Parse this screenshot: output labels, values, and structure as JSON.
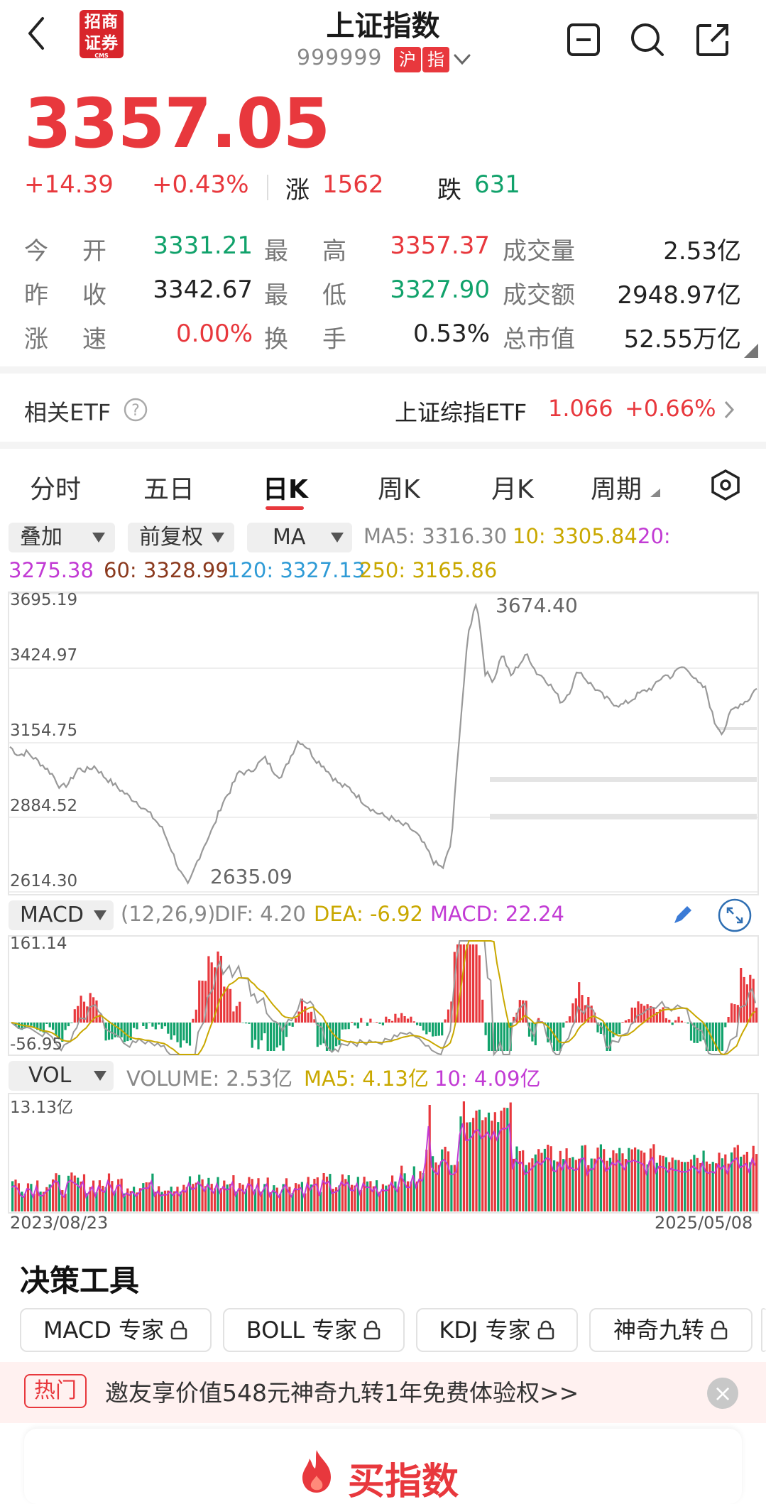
{
  "header": {
    "back_icon": "chevron-left-icon",
    "logo_text_top": "招商",
    "logo_text_bottom": "证券",
    "logo_small": "CMS",
    "title": "上证指数",
    "code": "999999",
    "tag1": "沪",
    "tag2": "指",
    "dropdown_icon": "chevron-down-icon",
    "icons": [
      "minus-square-icon",
      "search-icon",
      "share-icon"
    ]
  },
  "quote": {
    "price": "3357.05",
    "change": "+14.39",
    "change_pct": "+0.43%",
    "up_label": "涨",
    "up_count": "1562",
    "down_label": "跌",
    "down_count": "631",
    "rows": [
      {
        "l1": "今",
        "l2": "开",
        "v1": "3331.21",
        "c1": "green",
        "m1": "最",
        "m2": "高",
        "v2": "3357.37",
        "c2": "red",
        "n": "成交量",
        "v3": "2.53亿"
      },
      {
        "l1": "昨",
        "l2": "收",
        "v1": "3342.67",
        "c1": "dark",
        "m1": "最",
        "m2": "低",
        "v2": "3327.90",
        "c2": "green",
        "n": "成交额",
        "v3": "2948.97亿"
      },
      {
        "l1": "涨",
        "l2": "速",
        "v1": "0.00%",
        "c1": "red",
        "m1": "换",
        "m2": "手",
        "v2": "0.53%",
        "c2": "dark",
        "n": "总市值",
        "v3": "52.55万亿"
      }
    ]
  },
  "etf": {
    "label": "相关ETF",
    "name": "上证综指ETF",
    "price": "1.066",
    "pct": "+0.66%"
  },
  "tabs": [
    "分时",
    "五日",
    "日K",
    "周K",
    "月K",
    "周期"
  ],
  "active_tab": "日K",
  "controls": {
    "overlay": "叠加",
    "adjust": "前复权",
    "ma": "MA"
  },
  "ma_values": {
    "ma5": "MA5: 3316.30",
    "ma10": "10: 3305.84",
    "ma20_a": "20:",
    "ma20_b": "3275.38",
    "ma60": "60: 3328.99",
    "ma120": "120: 3327.13",
    "ma250": "250: 3165.86",
    "colors": {
      "ma5": "#888888",
      "ma10": "#c9a800",
      "ma20": "#c23bd4",
      "ma60": "#8b3a1e",
      "ma120": "#2f9bd6",
      "ma250": "#c9a800"
    }
  },
  "chart_data": {
    "type": "line",
    "y_ticks": [
      "3695.19",
      "3424.97",
      "3154.75",
      "2884.52",
      "2614.30"
    ],
    "ylim": [
      2614.3,
      3695.19
    ],
    "high_label": "3674.40",
    "low_label": "2635.09",
    "x_start": "2023/08/23",
    "x_end": "2025/05/08",
    "close_series": [
      3140,
      3110,
      3120,
      3095,
      3070,
      3040,
      2990,
      3010,
      3060,
      3055,
      3070,
      3035,
      3010,
      2985,
      2960,
      2940,
      2910,
      2880,
      2840,
      2770,
      2690,
      2635,
      2720,
      2790,
      2850,
      2935,
      2985,
      3050,
      3045,
      3070,
      3100,
      3055,
      3030,
      3100,
      3165,
      3140,
      3095,
      3070,
      3030,
      3000,
      2990,
      2960,
      2930,
      2905,
      2890,
      2880,
      2860,
      2850,
      2820,
      2775,
      2720,
      2700,
      2790,
      3200,
      3550,
      3674,
      3410,
      3380,
      3480,
      3395,
      3440,
      3475,
      3410,
      3390,
      3350,
      3300,
      3345,
      3420,
      3380,
      3350,
      3320,
      3300,
      3290,
      3305,
      3330,
      3345,
      3360,
      3400,
      3395,
      3430,
      3420,
      3370,
      3350,
      3230,
      3190,
      3270,
      3295,
      3310,
      3357
    ],
    "macd": {
      "label": "MACD",
      "params": "(12,26,9)",
      "dif": "DIF: 4.20",
      "dea": "DEA: -6.92",
      "macd": "MACD: 22.24",
      "ymax": "161.14",
      "ymin": "-56.95"
    },
    "vol": {
      "label": "VOL",
      "volume": "VOLUME: 2.53亿",
      "ma5": "MA5: 4.13亿",
      "ma10": "10: 4.09亿",
      "ymax": "13.13亿"
    }
  },
  "tools": {
    "title": "决策工具",
    "items": [
      "MACD 专家",
      "BOLL 专家",
      "KDJ 专家",
      "神奇九转"
    ],
    "lock_icon": "lock-icon"
  },
  "promo": {
    "tag": "热门",
    "text": "邀友享价值548元神奇九转1年免费体验权>>",
    "close": "×"
  },
  "buy": {
    "label": "买指数",
    "icon": "flame-icon"
  }
}
